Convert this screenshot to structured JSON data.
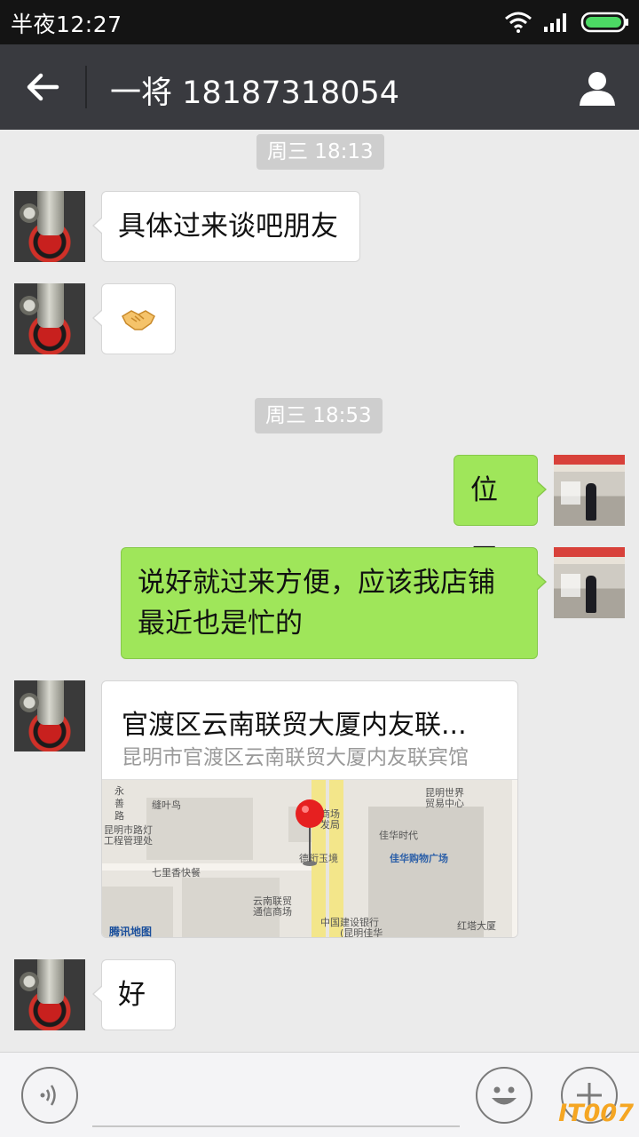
{
  "status_bar": {
    "time": "半夜12:27",
    "icons": [
      "wifi-icon",
      "signal-icon",
      "battery-icon"
    ]
  },
  "header": {
    "title": "一将 18187318054",
    "back_icon": "back-arrow-icon",
    "profile_icon": "person-icon"
  },
  "timestamps": [
    "周三 18:13",
    "周三 18:53"
  ],
  "messages": [
    {
      "from": "friend",
      "type": "text",
      "text": "具体过来谈吧朋友"
    },
    {
      "from": "friend",
      "type": "emoji",
      "text": "🤝"
    },
    {
      "from": "me",
      "type": "text",
      "text": "位置"
    },
    {
      "from": "me",
      "type": "text",
      "lines": [
        "说好就过来方便，应该我店铺",
        "最近也是忙的"
      ]
    },
    {
      "from": "friend",
      "type": "location",
      "name": "官渡区云南联贸大厦内友联...",
      "address": "昆明市官渡区云南联贸大厦内友联宾馆",
      "map_labels": [
        "永",
        "善",
        "路",
        "缝叶鸟",
        "昆明市路灯",
        "工程管理处",
        "七里香快餐",
        "云南联贸",
        "通信商场",
        "德珩玉境",
        "商场",
        "发局",
        "昆明世界",
        "贸易中心",
        "佳华时代",
        "佳华购物广场",
        "中国建设银行",
        "(昆明佳华",
        "红塔大厦",
        "腾讯地图"
      ]
    },
    {
      "from": "friend",
      "type": "text",
      "text": "好"
    }
  ],
  "input_bar": {
    "voice_icon": "voice-icon",
    "emoji_icon": "smiley-icon",
    "plus_icon": "plus-icon"
  },
  "watermark": "IT007",
  "colors": {
    "header_bg": "#393a3f",
    "status_bg": "#141414",
    "chat_bg": "#ebebeb",
    "out_bubble": "#9fe65a",
    "in_bubble": "#ffffff",
    "battery": "#4cd964",
    "map_pin": "#e62020"
  }
}
